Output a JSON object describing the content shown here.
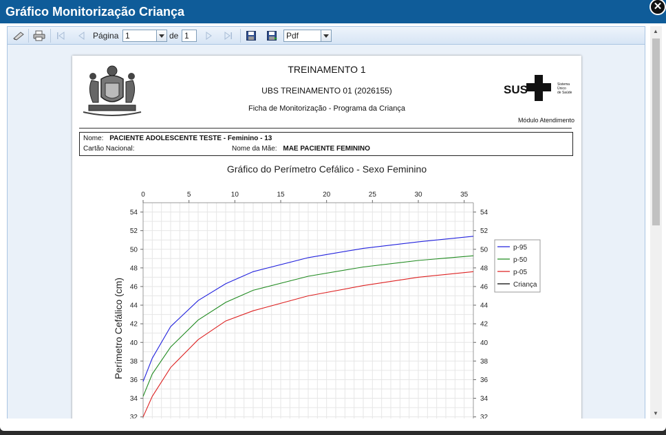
{
  "window": {
    "title": "Gráfico Monitorização Criança",
    "close_label": "✕"
  },
  "toolbar": {
    "page_label": "Página",
    "page_value": "1",
    "of_label": "de",
    "total_pages": "1",
    "format_value": "Pdf",
    "icons": [
      "edit-icon",
      "print-icon",
      "first-page-icon",
      "previous-page-icon",
      "next-page-icon",
      "last-page-icon",
      "save-icon",
      "export-icon"
    ]
  },
  "report": {
    "title": "TREINAMENTO 1",
    "unit": "UBS TREINAMENTO 01 (2026155)",
    "subtitle": "Ficha de Monitorização - Programa da Criança",
    "module": "Módulo Atendimento",
    "logo_text": "SUS",
    "logo_caption_1": "Sistema",
    "logo_caption_2": "Único",
    "logo_caption_3": "de Saúde"
  },
  "patient": {
    "name_label": "Nome:",
    "name_value": "PACIENTE ADOLESCENTE TESTE - Feminino - 13",
    "card_label": "Cartão Nacional:",
    "mother_label": "Nome da Mãe:",
    "mother_value": "MAE PACIENTE FEMININO"
  },
  "chart_data": {
    "type": "line",
    "title": "Gráfico do Perímetro Cefálico - Sexo Feminino",
    "xlabel": "",
    "ylabel": "Perímetro Cefálico (cm)",
    "xlim": [
      0,
      36
    ],
    "ylim": [
      31,
      55
    ],
    "xticks": [
      0,
      5,
      10,
      15,
      20,
      25,
      30,
      35
    ],
    "yticks": [
      32,
      34,
      36,
      38,
      40,
      42,
      44,
      46,
      48,
      50,
      52,
      54
    ],
    "grid": true,
    "legend": "right",
    "series": [
      {
        "name": "p-95",
        "color": "#2020dd",
        "x": [
          0,
          1,
          3,
          6,
          9,
          12,
          18,
          24,
          30,
          36
        ],
        "y": [
          35.8,
          38.3,
          41.7,
          44.5,
          46.3,
          47.6,
          49.1,
          50.1,
          50.8,
          51.4
        ]
      },
      {
        "name": "p-50",
        "color": "#1f8a1f",
        "x": [
          0,
          1,
          3,
          6,
          9,
          12,
          18,
          24,
          30,
          36
        ],
        "y": [
          34.2,
          36.6,
          39.5,
          42.4,
          44.3,
          45.6,
          47.1,
          48.1,
          48.8,
          49.3
        ]
      },
      {
        "name": "p-05",
        "color": "#dd2020",
        "x": [
          0,
          1,
          3,
          6,
          9,
          12,
          18,
          24,
          30,
          36
        ],
        "y": [
          32.0,
          34.2,
          37.3,
          40.3,
          42.3,
          43.4,
          45.0,
          46.1,
          47.0,
          47.6
        ]
      },
      {
        "name": "Criança",
        "color": "#000000",
        "x": [],
        "y": []
      }
    ]
  }
}
